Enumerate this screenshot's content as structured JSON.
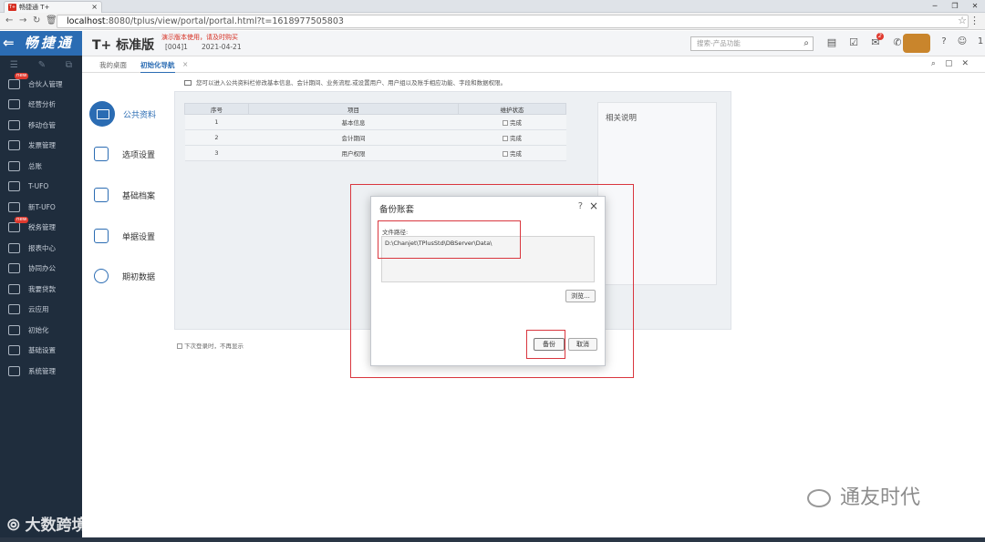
{
  "browser": {
    "tab_title": "畅捷通 T+",
    "tab_close": "×",
    "url_host": "localhost",
    "url_rest": ":8080/tplus/view/portal/portal.html?t=1618977505803"
  },
  "sidebar": {
    "logo": "畅捷通",
    "items": [
      {
        "label": "合伙人管理",
        "new": "new"
      },
      {
        "label": "经营分析",
        "new": ""
      },
      {
        "label": "移动仓管",
        "new": ""
      },
      {
        "label": "发票管理",
        "new": ""
      },
      {
        "label": "总账",
        "new": ""
      },
      {
        "label": "T-UFO",
        "new": ""
      },
      {
        "label": "新T-UFO",
        "new": ""
      },
      {
        "label": "税务管理",
        "new": "new"
      },
      {
        "label": "报表中心",
        "new": ""
      },
      {
        "label": "协同办公",
        "new": ""
      },
      {
        "label": "我要贷款",
        "new": ""
      },
      {
        "label": "云应用",
        "new": ""
      },
      {
        "label": "初始化",
        "new": ""
      },
      {
        "label": "基础设置",
        "new": ""
      },
      {
        "label": "系统管理",
        "new": ""
      }
    ]
  },
  "header": {
    "product": "T+ 标准版",
    "demo_notice": "演示版本使用，请及时购买",
    "account": "[004]1",
    "date": "2021-04-21",
    "search_placeholder": "搜索-产品功能",
    "message_badge": "2",
    "user_count": "1"
  },
  "worktabs": {
    "home": "我的桌面",
    "active": "初始化导航",
    "close": "×"
  },
  "content": {
    "notice": "您可以进入公共资料栏修改基本信息、会计期间、业务流程,或设置用户、用户组以及账手相应功能、字段和数据权限。",
    "leftnav": [
      "公共资料",
      "选项设置",
      "基础档案",
      "单据设置",
      "期初数据"
    ],
    "table": {
      "headers": [
        "序号",
        "项目",
        "维护状态"
      ],
      "rows": [
        {
          "no": "1",
          "item": "基本信息",
          "status": "完成"
        },
        {
          "no": "2",
          "item": "会计期间",
          "status": "完成"
        },
        {
          "no": "3",
          "item": "用户权限",
          "status": "完成"
        }
      ]
    },
    "related_title": "相关说明",
    "next_login": "下次登录时，不再显示"
  },
  "dialog": {
    "title": "备份账套",
    "path_label": "文件路径:",
    "path_value": "D:\\Chanjet\\TPlusStd\\DBServer\\Data\\",
    "browse": "浏览...",
    "backup": "备份",
    "cancel": "取消"
  },
  "watermarks": {
    "left": "大数跨境",
    "right": "通友时代"
  }
}
